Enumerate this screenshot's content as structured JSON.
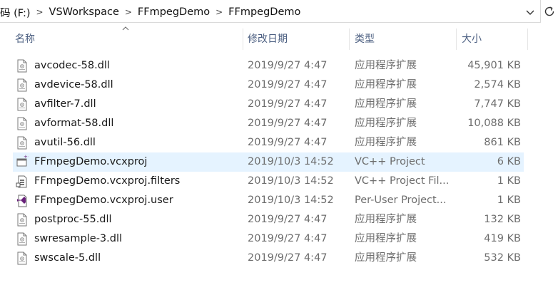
{
  "address_bar": {
    "breadcrumbs": [
      "码 (F:)",
      "VSWorkspace",
      "FFmpegDemo",
      "FFmpegDemo"
    ],
    "separator": ">"
  },
  "columns": {
    "name": "名称",
    "date": "修改日期",
    "type": "类型",
    "size": "大小"
  },
  "files": [
    {
      "name": "avcodec-58.dll",
      "date": "2019/9/27 4:47",
      "type": "应用程序扩展",
      "size": "45,901 KB",
      "icon": "dll-icon"
    },
    {
      "name": "avdevice-58.dll",
      "date": "2019/9/27 4:47",
      "type": "应用程序扩展",
      "size": "2,574 KB",
      "icon": "dll-icon"
    },
    {
      "name": "avfilter-7.dll",
      "date": "2019/9/27 4:47",
      "type": "应用程序扩展",
      "size": "7,747 KB",
      "icon": "dll-icon"
    },
    {
      "name": "avformat-58.dll",
      "date": "2019/9/27 4:47",
      "type": "应用程序扩展",
      "size": "10,088 KB",
      "icon": "dll-icon"
    },
    {
      "name": "avutil-56.dll",
      "date": "2019/9/27 4:47",
      "type": "应用程序扩展",
      "size": "861 KB",
      "icon": "dll-icon"
    },
    {
      "name": "FFmpegDemo.vcxproj",
      "date": "2019/10/3 14:52",
      "type": "VC++ Project",
      "size": "6 KB",
      "icon": "vcxproj-icon",
      "selected": true
    },
    {
      "name": "FFmpegDemo.vcxproj.filters",
      "date": "2019/10/3 14:52",
      "type": "VC++ Project Fil...",
      "size": "1 KB",
      "icon": "filters-icon"
    },
    {
      "name": "FFmpegDemo.vcxproj.user",
      "date": "2019/10/3 14:52",
      "type": "Per-User Project...",
      "size": "1 KB",
      "icon": "vs-user-icon"
    },
    {
      "name": "postproc-55.dll",
      "date": "2019/9/27 4:47",
      "type": "应用程序扩展",
      "size": "132 KB",
      "icon": "dll-icon"
    },
    {
      "name": "swresample-3.dll",
      "date": "2019/9/27 4:47",
      "type": "应用程序扩展",
      "size": "419 KB",
      "icon": "dll-icon"
    },
    {
      "name": "swscale-5.dll",
      "date": "2019/9/27 4:47",
      "type": "应用程序扩展",
      "size": "532 KB",
      "icon": "dll-icon"
    }
  ],
  "colors": {
    "selection": "#e5f3ff",
    "header_text": "#4d6082",
    "meta_text": "#6d6d6d"
  }
}
